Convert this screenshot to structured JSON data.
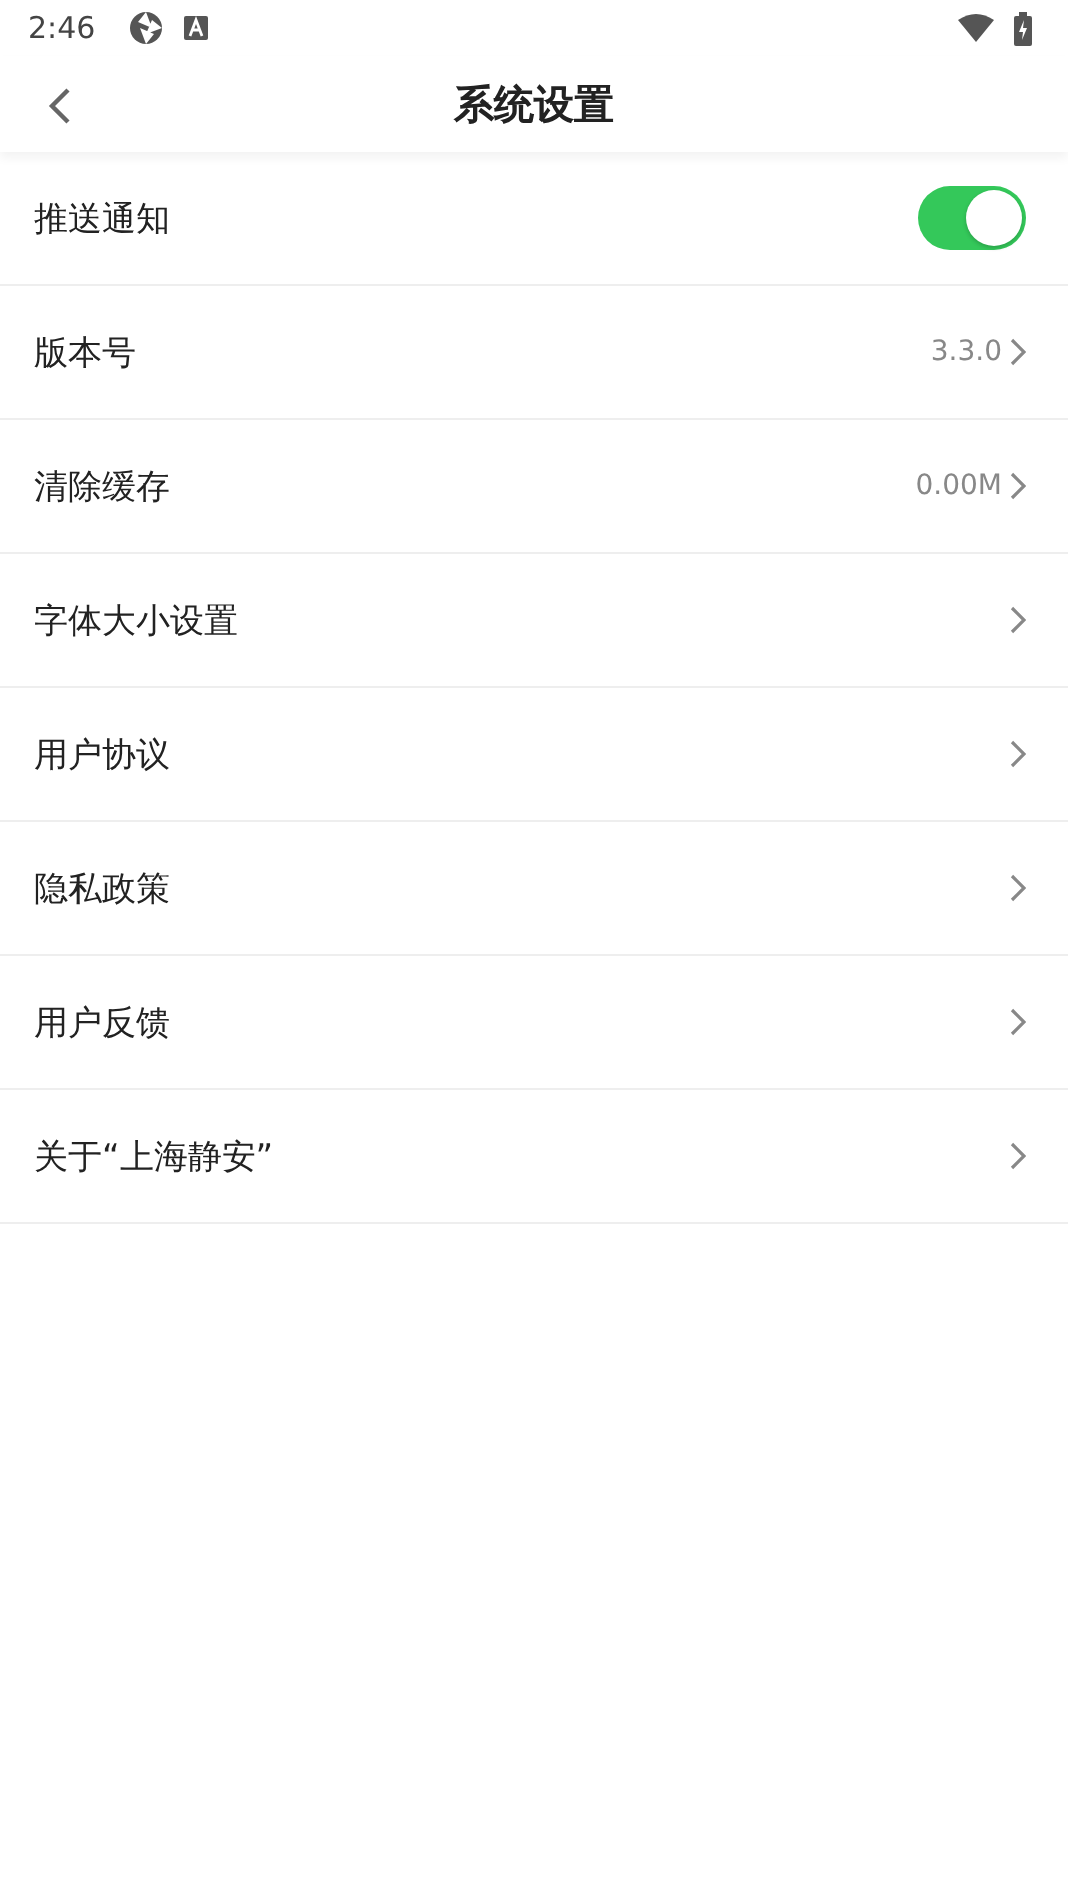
{
  "status_bar": {
    "time": "2:46"
  },
  "header": {
    "title": "系统设置"
  },
  "settings": [
    {
      "kind": "toggle",
      "label": "推送通知",
      "on": true
    },
    {
      "kind": "link",
      "label": "版本号",
      "value": "3.3.0"
    },
    {
      "kind": "link",
      "label": "清除缓存",
      "value": "0.00M"
    },
    {
      "kind": "link",
      "label": "字体大小设置"
    },
    {
      "kind": "link",
      "label": "用户协议"
    },
    {
      "kind": "link",
      "label": "隐私政策"
    },
    {
      "kind": "link",
      "label": "用户反馈"
    },
    {
      "kind": "link",
      "label": "关于“上海静安”"
    }
  ]
}
